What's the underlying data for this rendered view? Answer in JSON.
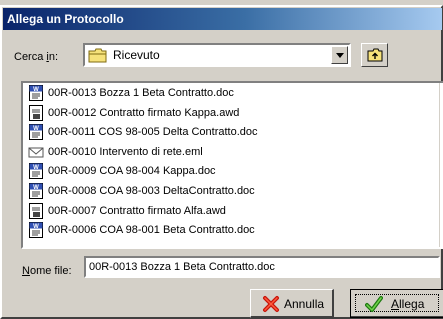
{
  "window": {
    "title": "Allega un Protocollo"
  },
  "lookin": {
    "label_pre": "Cerca ",
    "label_accel": "i",
    "label_post": "n:",
    "value": "Ricevuto",
    "folder_icon": "folder-icon",
    "dropdown_icon": "chevron-down-icon",
    "up_icon": "up-one-level-icon"
  },
  "files": [
    {
      "name": "00R-0013 Bozza 1 Beta Contratto.doc",
      "icon": "word-doc-icon",
      "selected": false
    },
    {
      "name": "00R-0012 Contratto firmato Kappa.awd",
      "icon": "fax-document-icon",
      "selected": false
    },
    {
      "name": "00R-0011 COS 98-005 Delta Contratto.doc",
      "icon": "word-doc-icon",
      "selected": false
    },
    {
      "name": "00R-0010 Intervento di rete.eml",
      "icon": "email-message-icon",
      "selected": false
    },
    {
      "name": "00R-0009 COA 98-004 Kappa.doc",
      "icon": "word-doc-icon",
      "selected": false
    },
    {
      "name": "00R-0008 COA 98-003 DeltaContratto.doc",
      "icon": "word-doc-icon",
      "selected": false
    },
    {
      "name": "00R-0007 Contratto firmato Alfa.awd",
      "icon": "fax-document-icon",
      "selected": false
    },
    {
      "name": "00R-0006 COA 98-001 Beta Contratto.doc",
      "icon": "word-doc-icon",
      "selected": false
    }
  ],
  "filename": {
    "label_accel": "N",
    "label_rest": "ome file:",
    "value": "00R-0013 Bozza 1 Beta Contratto.doc"
  },
  "buttons": {
    "cancel_label": "Annulla",
    "cancel_icon": "red-x-icon",
    "attach_accel": "A",
    "attach_rest": "llega",
    "attach_icon": "green-checkmark-icon"
  },
  "colors": {
    "titlebar_start": "#0a246a",
    "titlebar_end": "#a6caf0",
    "dialog_face": "#d4d0c8"
  }
}
